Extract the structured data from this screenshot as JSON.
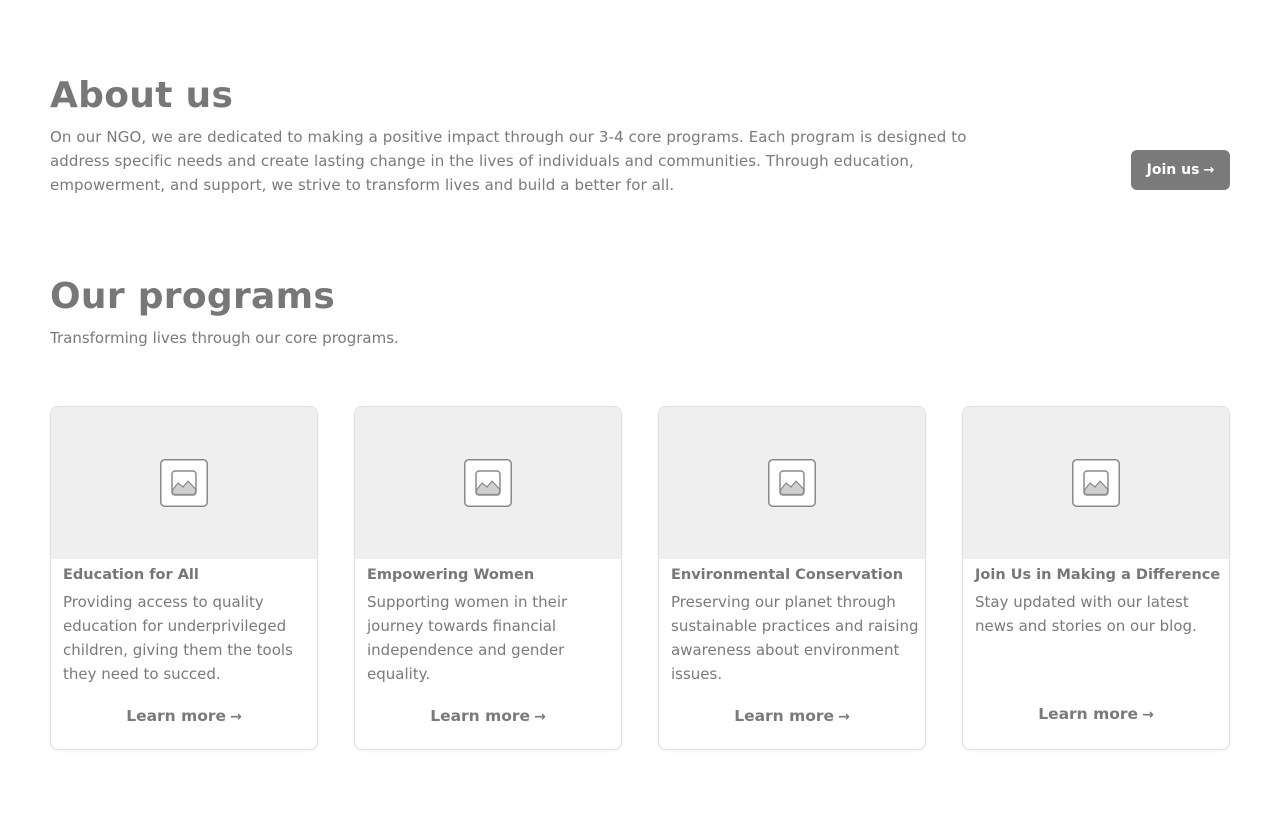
{
  "about": {
    "title": "About us",
    "description": "On our NGO, we are dedicated to making a positive impact through our 3-4 core programs. Each program is designed to address specific needs and create lasting change in the lives of individuals and communities. Through education, empowerment, and support, we strive to transform lives and build a better for all.",
    "join_label": "Join us",
    "join_icon": "arrow-right-icon"
  },
  "programs": {
    "title": "Our programs",
    "subtitle": "Transforming lives through our core programs.",
    "cards": [
      {
        "title": "Education for All",
        "description": "Providing access to quality education for underprivileged children, giving them the tools they need to succed.",
        "link_label": "Learn more",
        "image_icon": "image-placeholder-icon"
      },
      {
        "title": "Empowering Women",
        "description": "Supporting women in their journey towards financial independence and gender equality.",
        "link_label": "Learn more",
        "image_icon": "image-placeholder-icon"
      },
      {
        "title": "Environmental Conservation",
        "description": "Preserving our planet through sustainable practices and raising awareness about environment issues.",
        "link_label": "Learn more",
        "image_icon": "image-placeholder-icon"
      },
      {
        "title": "Join Us in Making a Difference",
        "description": "Stay updated with our latest news and stories on our blog.",
        "link_label": "Learn more",
        "image_icon": "image-placeholder-icon"
      }
    ]
  },
  "colors": {
    "text": "#777777",
    "button_bg": "#7a7a7a",
    "thumb_bg": "#efefef",
    "border": "#e2e2e2"
  }
}
